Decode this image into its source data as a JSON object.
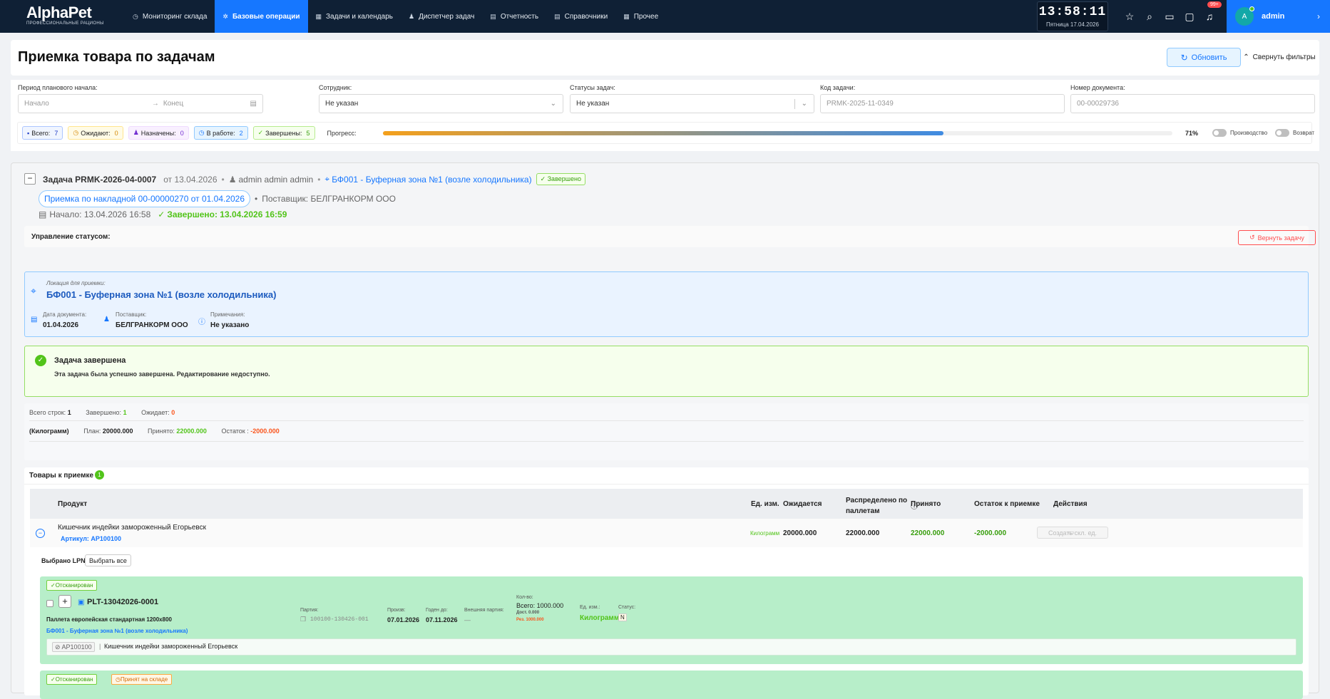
{
  "app": {
    "logo": "AlphaPet",
    "logo_sub": "ПРОФЕССИОНАЛЬНЫЕ РАЦИОНЫ"
  },
  "nav": [
    {
      "label": "Мониторинг склада",
      "icon": "dashboard-icon"
    },
    {
      "label": "Базовые операции",
      "icon": "gear-icon",
      "active": true
    },
    {
      "label": "Задачи и календарь",
      "icon": "calendar-icon"
    },
    {
      "label": "Диспетчер задач",
      "icon": "user-icon"
    },
    {
      "label": "Отчетность",
      "icon": "file-icon"
    },
    {
      "label": "Справочники",
      "icon": "book-icon"
    },
    {
      "label": "Прочее",
      "icon": "grid-icon"
    }
  ],
  "clock": {
    "time": "13:58:11",
    "date": "Пятница 17.04.2026"
  },
  "notifications_badge": "99+",
  "user": {
    "initial": "A",
    "name": "admin"
  },
  "page": {
    "title": "Приемка товара по задачам",
    "refresh": "Обновить",
    "collapse_filters": "Свернуть фильтры"
  },
  "filters": {
    "period_label": "Период планового начала:",
    "start_placeholder": "Начало",
    "end_placeholder": "Конец",
    "employee_label": "Сотрудник:",
    "employee_value": "Не указан",
    "status_label": "Статусы задач:",
    "status_value": "Не указан",
    "code_label": "Код задачи:",
    "code_placeholder": "PRMK-2025-11-0349",
    "doc_label": "Номер документа:",
    "doc_placeholder": "00-00029736"
  },
  "stats": {
    "total_label": "Всего:",
    "total": "7",
    "waiting_label": "Ожидают:",
    "waiting": "0",
    "assigned_label": "Назначены:",
    "assigned": "0",
    "inwork_label": "В работе:",
    "inwork": "2",
    "done_label": "Завершены:",
    "done": "5",
    "progress_label": "Прогресс:",
    "progress_pct": "71%",
    "progress_value": 0.71,
    "toggle_production": "Производство",
    "toggle_return": "Возврат"
  },
  "task": {
    "title": "Задача PRMK-2026-04-0007",
    "date": "от 13.04.2026",
    "user": "admin admin admin",
    "location": "БФ001 - Буферная зона №1 (возле холодильника)",
    "status": "Завершено",
    "doc_pill": "Приемка по накладной 00-00000270 от 01.04.2026",
    "supplier": "Поставщик: БЕЛГРАНКОРМ ООО",
    "start": "Начало: 13.04.2026 16:58",
    "finished": "Завершено: 13.04.2026 16:59",
    "status_control": "Управление статусом:",
    "return_btn": "Вернуть задачу",
    "loc_label": "Локация для приемки:",
    "loc_value": "БФ001 - Буферная зона №1 (возле холодильника)",
    "docdate_label": "Дата документа:",
    "docdate": "01.04.2026",
    "supplier_label": "Поставщик:",
    "supplier_value": "БЕЛГРАНКОРМ ООО",
    "notes_label": "Примечания:",
    "notes": "Не указано",
    "done_title": "Задача завершена",
    "done_text": "Эта задача была успешно завершена. Редактирование недоступно.",
    "rows_label": "Всего строк:",
    "rows": "1",
    "completed_label": "Завершено:",
    "completed": "1",
    "awaiting_label": "Ожидает:",
    "awaiting": "0",
    "unit": "(Килограмм)",
    "plan_label": "План:",
    "plan": "20000.000",
    "accepted_label": "Принято:",
    "accepted": "22000.000",
    "rest_label": "Остаток :",
    "rest": "-2000.000"
  },
  "goods": {
    "title": "Товары к приемке",
    "count": "1",
    "headers": {
      "product": "Продукт",
      "unit": "Ед. изм.",
      "expected": "Ожидается",
      "distributed": "Распределено по паллетам",
      "accepted": "Принято",
      "rest": "Остаток к приемке",
      "actions": "Действия"
    },
    "row": {
      "name": "Кишечник индейки замороженный Егорьевск",
      "article": "Артикул: AP100100",
      "unit": "Килограмм",
      "expected": "20000.000",
      "distributed": "22000.000",
      "accepted": "22000.000",
      "rest": "-2000.000",
      "action": "Создать скл. ед."
    },
    "selected_lpn": "Выбрано LPN: 0",
    "select_all": "Выбрать все"
  },
  "pallet": {
    "tag": "Отсканирован",
    "plus": "+",
    "lpn": "PLT-13042026-0001",
    "type": "Паллета европейская стандартная 1200x800",
    "location": "БФ001 - Буферная зона №1 (возле холодильника)",
    "batch_label": "Партия:",
    "batch": "100100-130426-001",
    "prod_label": "Произв:",
    "prod": "07.01.2026",
    "exp_label": "Годен до:",
    "exp": "07.11.2026",
    "ext_label": "Внешняя партия:",
    "ext": "—",
    "qty_label": "Кол-во:",
    "qty_total": "Всего: 1000.000",
    "qty_avail": "Дост. 0.000",
    "qty_res": "Рез. 1000.000",
    "unit_label": "Ед. изм.:",
    "unit": "Килограмм",
    "status_label": "Статус:",
    "status": "N",
    "item_code": "AP100100",
    "item_name": "Кишечник индейки замороженный Егорьевск"
  },
  "pallet2": {
    "tag1": "Отсканирован",
    "tag2": "Принят на складе"
  },
  "colors": {
    "nav_bg": "#0f2035",
    "accent": "#1677ff",
    "success": "#52c41a",
    "danger": "#ff4d4f",
    "pallet_bg": "#b7eec9"
  }
}
